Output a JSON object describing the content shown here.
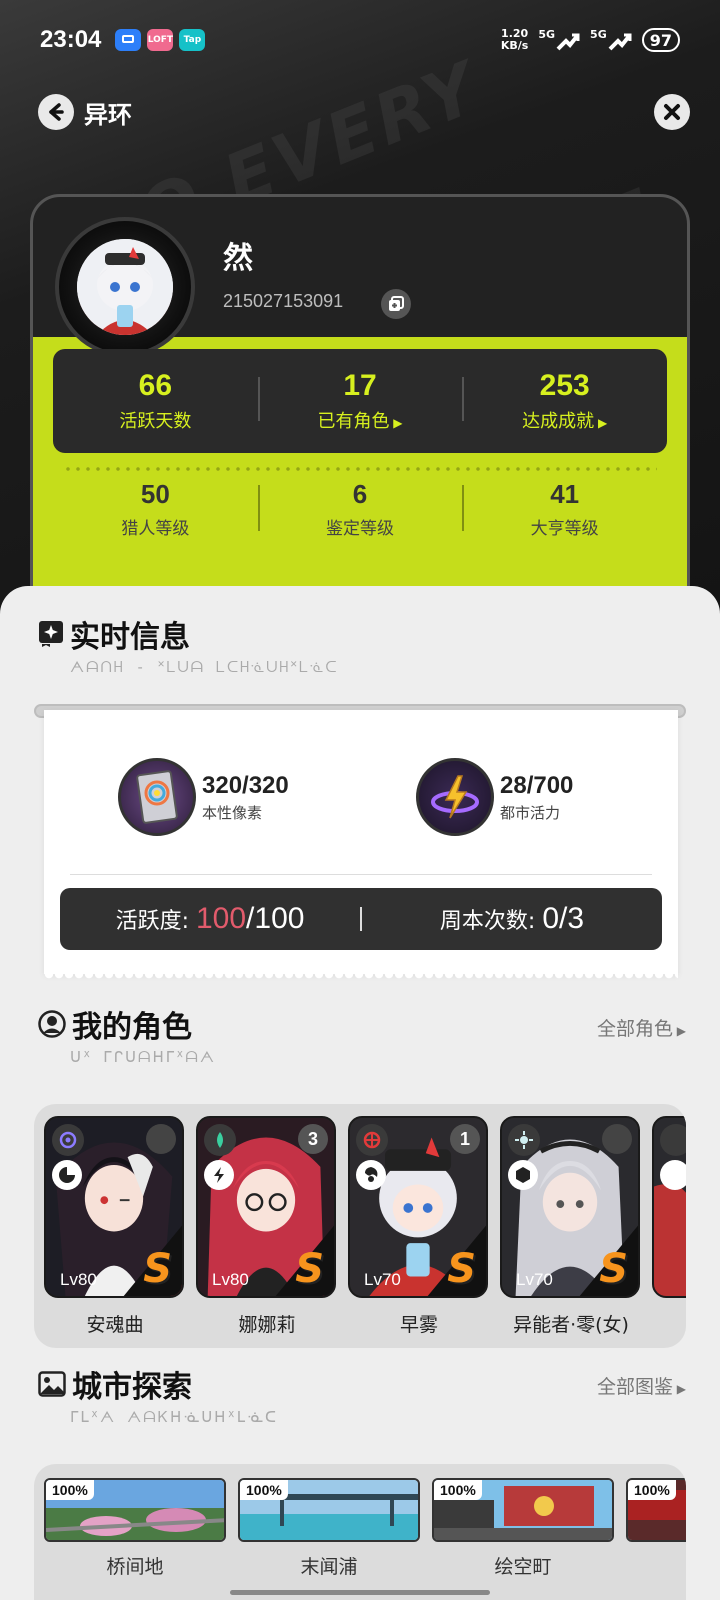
{
  "status_bar": {
    "time": "23:04",
    "apps": [
      {
        "icon": "chat-app-icon",
        "label": "",
        "color": "#2d7ff9"
      },
      {
        "icon": "lofter-app-icon",
        "label": "LOFT",
        "color": "#f06a8f"
      },
      {
        "icon": "taptap-app-icon",
        "label": "Tap",
        "color": "#16c1c8"
      }
    ],
    "net_speed_value": "1.20",
    "net_speed_unit": "KB/s",
    "signal_1": "5G",
    "signal_2": "5G",
    "battery": "97"
  },
  "nav": {
    "title": "异环"
  },
  "profile": {
    "name": "然",
    "id": "215027153091",
    "stats_primary": [
      {
        "value": "66",
        "label": "活跃天数",
        "has_arrow": false
      },
      {
        "value": "17",
        "label": "已有角色",
        "has_arrow": true
      },
      {
        "value": "253",
        "label": "达成成就",
        "has_arrow": true
      }
    ],
    "stats_secondary": [
      {
        "value": "50",
        "label": "猎人等级"
      },
      {
        "value": "6",
        "label": "鉴定等级"
      },
      {
        "value": "41",
        "label": "大亨等级"
      }
    ]
  },
  "realtime": {
    "title": "实时信息",
    "subtitle": "ᗅᗩᑎᕼ - ᕁᒪᑌᗩ ᒪᑕᕼᓍᑌᕼᕁᒪᓍᑕ",
    "resources": [
      {
        "value": "320/320",
        "label": "本性像素",
        "icon": "pixel-card-icon"
      },
      {
        "value": "28/700",
        "label": "都市活力",
        "icon": "lightning-icon"
      }
    ],
    "activity_label": "活跃度:",
    "activity_current": "100",
    "activity_max": "/100",
    "weekly_label": "周本次数:",
    "weekly_value": "0/3"
  },
  "characters": {
    "title": "我的角色",
    "subtitle": "ᑌᕁ ᒥᒋᑌᗩᕼᒥᕁᗩᗅ",
    "more": "全部角色",
    "list": [
      {
        "name": "安魂曲",
        "level": "Lv80",
        "rank": "S",
        "star": "",
        "attr_color": "#8c7cff",
        "palette": [
          "#1d1d25",
          "#5a3040",
          "#d23c3c"
        ]
      },
      {
        "name": "娜娜莉",
        "level": "Lv80",
        "rank": "S",
        "star": "3",
        "attr_color": "#3ad0a0",
        "palette": [
          "#2a1b22",
          "#c43246",
          "#f3d7d7"
        ]
      },
      {
        "name": "早雾",
        "level": "Lv70",
        "rank": "S",
        "star": "1",
        "attr_color": "#e23a3a",
        "palette": [
          "#2c2a2e",
          "#e9e9ef",
          "#c9332f"
        ]
      },
      {
        "name": "异能者·零(女)",
        "level": "Lv70",
        "rank": "S",
        "star": "",
        "attr_color": "#cfeef0",
        "palette": [
          "#2a2a2e",
          "#cfcfd6",
          "#3d3d46"
        ]
      }
    ]
  },
  "city": {
    "title": "城市探索",
    "subtitle": "ᒥᒪᕁᗅ ᗅᗩᏦᕼᓍᑌᕼᕁᒪᓍᑕ",
    "more": "全部图鉴",
    "list": [
      {
        "name": "桥间地",
        "progress": "100%",
        "palette": [
          "#6aa6e0",
          "#4b7b45",
          "#d58ab5"
        ]
      },
      {
        "name": "末闻浦",
        "progress": "100%",
        "palette": [
          "#9cc9e8",
          "#2f4754",
          "#3fb3c9"
        ]
      },
      {
        "name": "绘空町",
        "progress": "100%",
        "palette": [
          "#7ec0e8",
          "#b73a3a",
          "#3a3a3a"
        ]
      },
      {
        "name": "",
        "progress": "100%",
        "palette": [
          "#5a2a2a",
          "#a22",
          "#333"
        ]
      }
    ]
  },
  "colors": {
    "lime": "#c5dd1b",
    "lime_text": "#d7f01f",
    "rank_orange": "#f7941d",
    "activity_red": "#e25b6c"
  }
}
